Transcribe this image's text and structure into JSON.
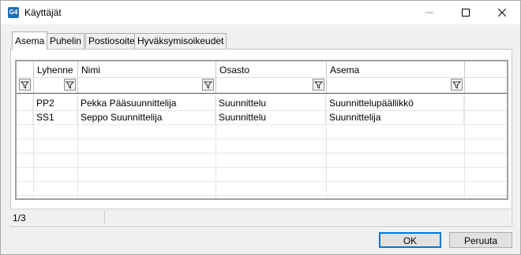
{
  "window": {
    "title": "Käyttäjät",
    "app_icon_text": "G4"
  },
  "tabs": [
    {
      "label": "Asema",
      "active": true
    },
    {
      "label": "Puhelin"
    },
    {
      "label": "Postiosoite"
    },
    {
      "label": "Hyväksymisoikeudet"
    }
  ],
  "grid": {
    "columns": [
      "Lyhenne",
      "Nimi",
      "Osasto",
      "Asema"
    ],
    "rows": [
      [
        "PP2",
        "Pekka Pääsuunnittelija",
        "Suunnittelu",
        "Suunnittelupäällikkö"
      ],
      [
        "SS1",
        "Seppo Suunnittelija",
        "Suunnittelu",
        "Suunnittelija"
      ]
    ]
  },
  "status": {
    "record_position": "1/3"
  },
  "buttons": {
    "ok": "OK",
    "cancel": "Peruuta"
  },
  "icons": {
    "filter": "filter-funnel-icon",
    "minimize": "minimize-icon",
    "maximize": "maximize-icon",
    "close": "close-icon"
  }
}
